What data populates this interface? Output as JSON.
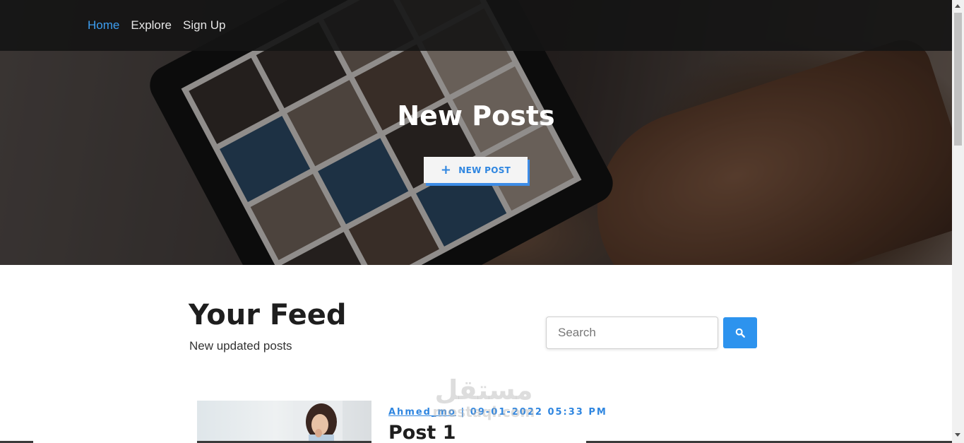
{
  "nav": {
    "items": [
      {
        "label": "Home",
        "active": true
      },
      {
        "label": "Explore",
        "active": false
      },
      {
        "label": "Sign Up",
        "active": false
      }
    ]
  },
  "hero": {
    "title": "New Posts",
    "button_icon": "plus-icon",
    "button_label": "NEW POST"
  },
  "feed": {
    "title": "Your Feed",
    "subtitle": "New updated posts"
  },
  "search": {
    "placeholder": "Search",
    "button_icon": "search-icon"
  },
  "posts": [
    {
      "author": "Ahmed_mo",
      "separator": "|",
      "datetime": "09-01-2022 05:33 PM",
      "title": "Post 1"
    }
  ],
  "watermark": {
    "arabic": "مستقل",
    "latin": "mostaql.com"
  },
  "colors": {
    "accent": "#2d93ee",
    "nav_active": "#3d9ef0",
    "navbar_bg": "#141414"
  }
}
